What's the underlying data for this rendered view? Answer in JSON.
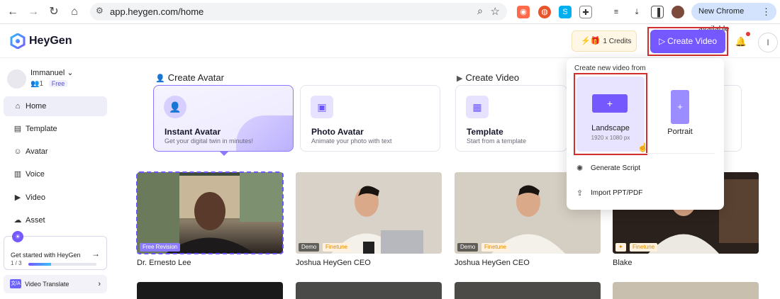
{
  "browser": {
    "url": "app.heygen.com/home",
    "update_label": "New Chrome available"
  },
  "header": {
    "brand": "HeyGen",
    "credits_label": "1 Credits",
    "create_video_label": "Create Video",
    "account_initial": "I"
  },
  "sidebar": {
    "workspace_name": "Immanuel",
    "members_count": "1",
    "plan": "Free",
    "items": [
      {
        "label": "Home",
        "icon": "home-icon"
      },
      {
        "label": "Template",
        "icon": "template-icon"
      },
      {
        "label": "Avatar",
        "icon": "avatar-icon"
      },
      {
        "label": "Voice",
        "icon": "voice-icon"
      },
      {
        "label": "Video",
        "icon": "video-icon"
      },
      {
        "label": "Asset",
        "icon": "asset-icon"
      }
    ],
    "get_started": {
      "title": "Get started with HeyGen",
      "step": "1 / 3",
      "progress": 0.33
    },
    "video_translate": {
      "label": "Video Translate",
      "badge": "文/A"
    }
  },
  "main": {
    "create_avatar_title": "Create Avatar",
    "create_video_title": "Create Video",
    "cards": [
      {
        "name": "Instant Avatar",
        "desc": "Get your digital twin in minutes!"
      },
      {
        "name": "Photo Avatar",
        "desc": "Animate your photo with text"
      },
      {
        "name": "Template",
        "desc": "Start from a template"
      }
    ],
    "avatars": [
      {
        "name": "Dr. Ernesto Lee",
        "tags": [
          "Free Revision"
        ]
      },
      {
        "name": "Joshua HeyGen CEO",
        "tags": [
          "Demo",
          "Finetune"
        ]
      },
      {
        "name": "Joshua HeyGen CEO",
        "tags": [
          "Demo",
          "Finetune"
        ]
      },
      {
        "name": "Blake",
        "tags": [
          "✦",
          "Finetune"
        ]
      }
    ]
  },
  "dropdown": {
    "title": "Create new video from",
    "landscape": {
      "label": "Landscape",
      "size": "1920 x 1080 px"
    },
    "portrait": {
      "label": "Portrait"
    },
    "items": [
      {
        "label": "Generate Script",
        "icon": "openai-icon"
      },
      {
        "label": "Import PPT/PDF",
        "icon": "upload-icon"
      }
    ]
  },
  "colors": {
    "accent": "#7559ff",
    "highlight": "#d32f2f"
  }
}
